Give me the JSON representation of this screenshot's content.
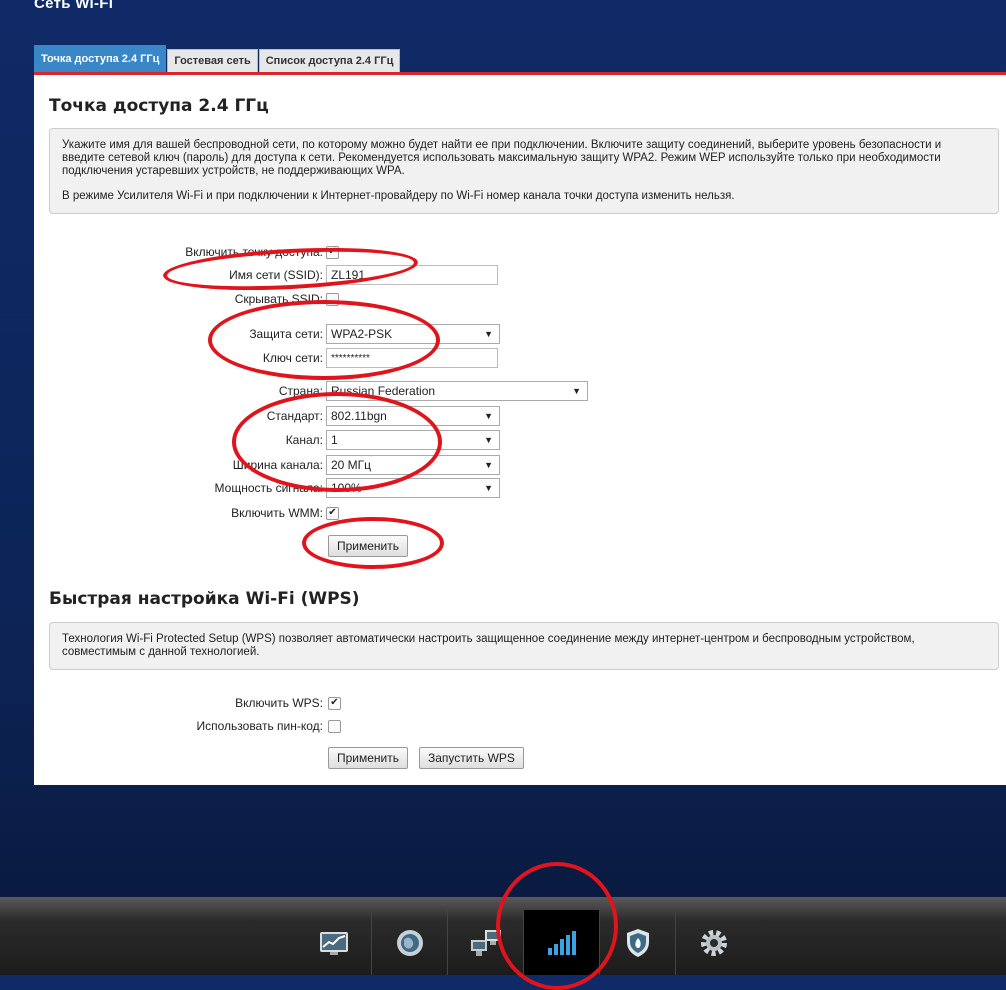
{
  "page": {
    "title": "Сеть Wi-Fi"
  },
  "tabs": [
    {
      "label": "Точка доступа 2.4 ГГц",
      "active": true
    },
    {
      "label": "Гостевая сеть",
      "active": false
    },
    {
      "label": "Список доступа 2.4 ГГц",
      "active": false
    }
  ],
  "ap": {
    "title": "Точка доступа 2.4 ГГц",
    "info1": "Укажите имя для вашей беспроводной сети, по которому можно будет найти ее при подключении. Включите защиту соединений, выберите уровень безопасности и введите сетевой ключ (пароль) для доступа к сети. Рекомендуется использовать максимальную защиту WPA2. Режим WEP используйте только при необходимости подключения устаревших устройств, не поддерживающих WPA.",
    "info2": "В режиме Усилителя Wi-Fi и при подключении к Интернет-провайдеру по Wi-Fi номер канала точки доступа изменить нельзя.",
    "enable_label": "Включить точку доступа:",
    "enable_checked": true,
    "ssid_label": "Имя сети (SSID):",
    "ssid_value": "ZL191",
    "hide_ssid_label": "Скрывать SSID:",
    "hide_ssid_checked": false,
    "security_label": "Защита сети:",
    "security_value": "WPA2-PSK",
    "key_label": "Ключ сети:",
    "key_value": "**********",
    "country_label": "Страна:",
    "country_value": "Russian Federation",
    "standard_label": "Стандарт:",
    "standard_value": "802.11bgn",
    "channel_label": "Канал:",
    "channel_value": "1",
    "width_label": "Ширина канала:",
    "width_value": "20 МГц",
    "power_label": "Мощность сигнала:",
    "power_value": "100%",
    "wmm_label": "Включить WMM:",
    "wmm_checked": true,
    "apply_label": "Применить"
  },
  "wps": {
    "title": "Быстрая настройка Wi-Fi (WPS)",
    "info": "Технология Wi-Fi Protected Setup (WPS) позволяет автоматически настроить защищенное соединение между интернет-центром и беспроводным устройством, совместимым с данной технологией.",
    "enable_label": "Включить WPS:",
    "enable_checked": true,
    "pin_label": "Использовать пин-код:",
    "pin_checked": false,
    "apply_label": "Применить",
    "start_label": "Запустить WPS"
  },
  "bottom_nav": [
    {
      "icon": "monitor-chart-icon",
      "active": false
    },
    {
      "icon": "globe-icon",
      "active": false
    },
    {
      "icon": "network-computers-icon",
      "active": false
    },
    {
      "icon": "wifi-signal-bars-icon",
      "active": true
    },
    {
      "icon": "shield-flame-icon",
      "active": false
    },
    {
      "icon": "gear-icon",
      "active": false
    }
  ],
  "colors": {
    "active_tab": "#3a87c8",
    "accent_red": "#d9262c",
    "annotation_red": "#e0141c",
    "background": "#0f2a66"
  }
}
